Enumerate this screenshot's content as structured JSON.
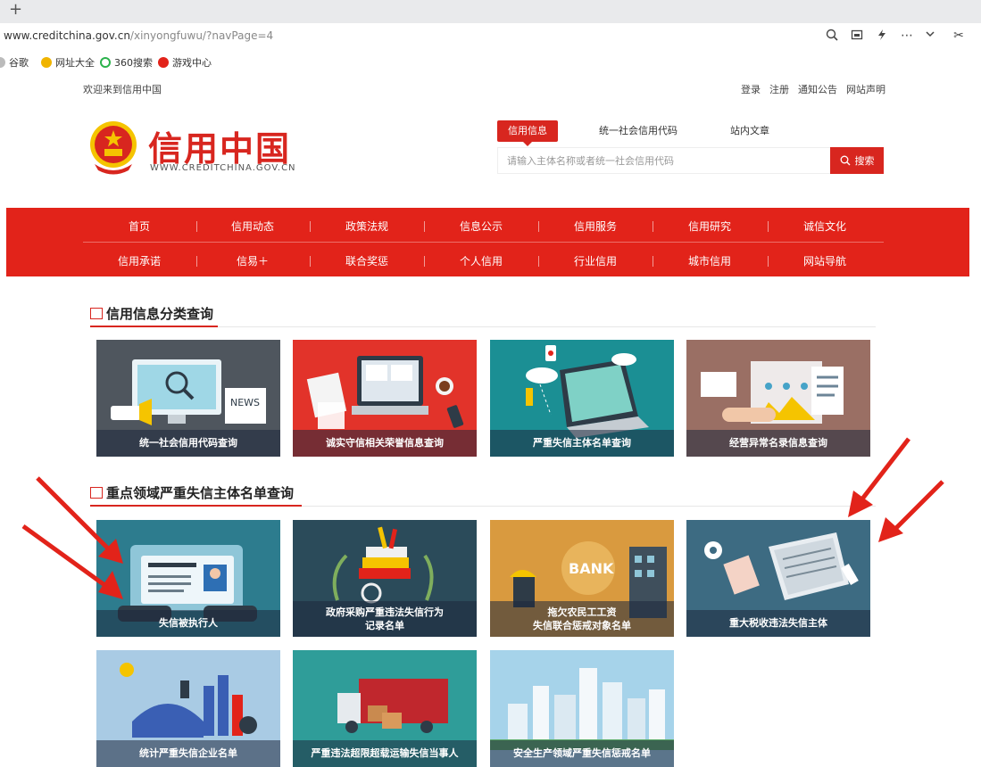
{
  "browser": {
    "new_tab": "+",
    "url_host": "www.creditchina.gov.cn",
    "url_path": "/xinyongfuwu/?navPage=4",
    "bookmarks": [
      "谷歌",
      "网址大全",
      "360搜索",
      "游戏中心"
    ]
  },
  "header": {
    "welcome": "欢迎来到信用中国",
    "links": [
      "登录",
      "注册",
      "通知公告",
      "网站声明"
    ],
    "logo_title": "信用中国",
    "logo_sub": "WWW.CREDITCHINA.GOV.CN"
  },
  "search": {
    "tabs": [
      "信用信息",
      "统一社会信用代码",
      "站内文章"
    ],
    "active_tab": "信用信息",
    "placeholder": "请输入主体名称或者统一社会信用代码",
    "button_label": "搜索"
  },
  "nav": {
    "row1": [
      "首页",
      "信用动态",
      "政策法规",
      "信息公示",
      "信用服务",
      "信用研究",
      "诚信文化"
    ],
    "row2": [
      "信用承诺",
      "信易＋",
      "联合奖惩",
      "个人信用",
      "行业信用",
      "城市信用",
      "网站导航"
    ]
  },
  "section1": {
    "title": "信用信息分类查询",
    "cards": [
      "统一社会信用代码查询",
      "诚实守信相关荣誉信息查询",
      "严重失信主体名单查询",
      "经营异常名录信息查询"
    ]
  },
  "section2": {
    "title": "重点领域严重失信主体名单查询",
    "cards": [
      {
        "line1": "失信被执行人",
        "line2": ""
      },
      {
        "line1": "政府采购严重违法失信行为",
        "line2": "记录名单"
      },
      {
        "line1": "拖欠农民工工资",
        "line2": "失信联合惩戒对象名单"
      },
      {
        "line1": "重大税收违法失信主体",
        "line2": ""
      },
      {
        "line1": "统计严重失信企业名单",
        "line2": ""
      },
      {
        "line1": "严重违法超限超载运输失信当事人",
        "line2": ""
      },
      {
        "line1": "安全生产领域严重失信惩戒名单",
        "line2": ""
      }
    ]
  },
  "colors": {
    "brand_red": "#e2231a",
    "accent_red": "#d8261f"
  }
}
